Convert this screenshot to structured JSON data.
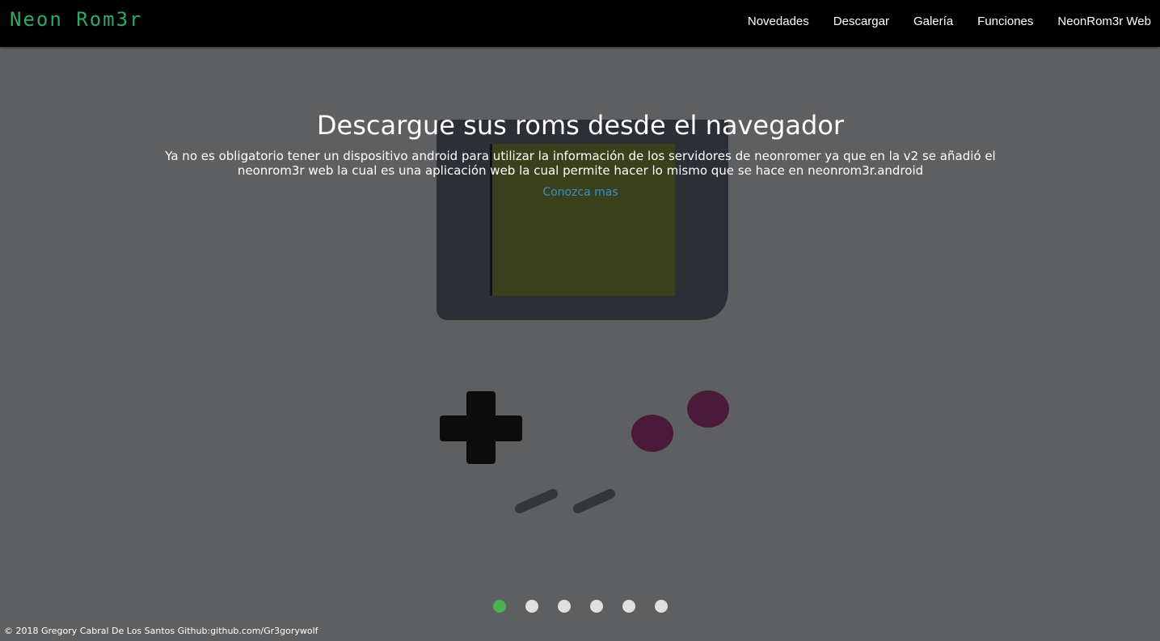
{
  "navbar": {
    "brand": "Neon Rom3r",
    "links": [
      "Novedades",
      "Descargar",
      "Galería",
      "Funciones",
      "NeonRom3r Web"
    ]
  },
  "hero": {
    "title": "Descargue sus roms desde el navegador",
    "text": "Ya no es obligatorio tener un dispositivo android para utilizar la información de los servidores de neonromer ya que en la v2 se añadió el neonrom3r web la cual es una aplicación web la cual permite hacer lo mismo que se hace en neonrom3r.android",
    "link": "Conozca mas"
  },
  "carousel": {
    "slide_count": 6,
    "active_index": 0
  },
  "footer": {
    "text": "© 2018 Gregory Cabral De Los Santos Github:github.com/Gr3gorywolf"
  },
  "colors": {
    "brand": "#2fa86a",
    "background": "#5e5f61",
    "navbar": "#000000",
    "link": "#3a8fd0",
    "active_dot": "#4caf50",
    "inactive_dot": "#e0e0e0"
  }
}
